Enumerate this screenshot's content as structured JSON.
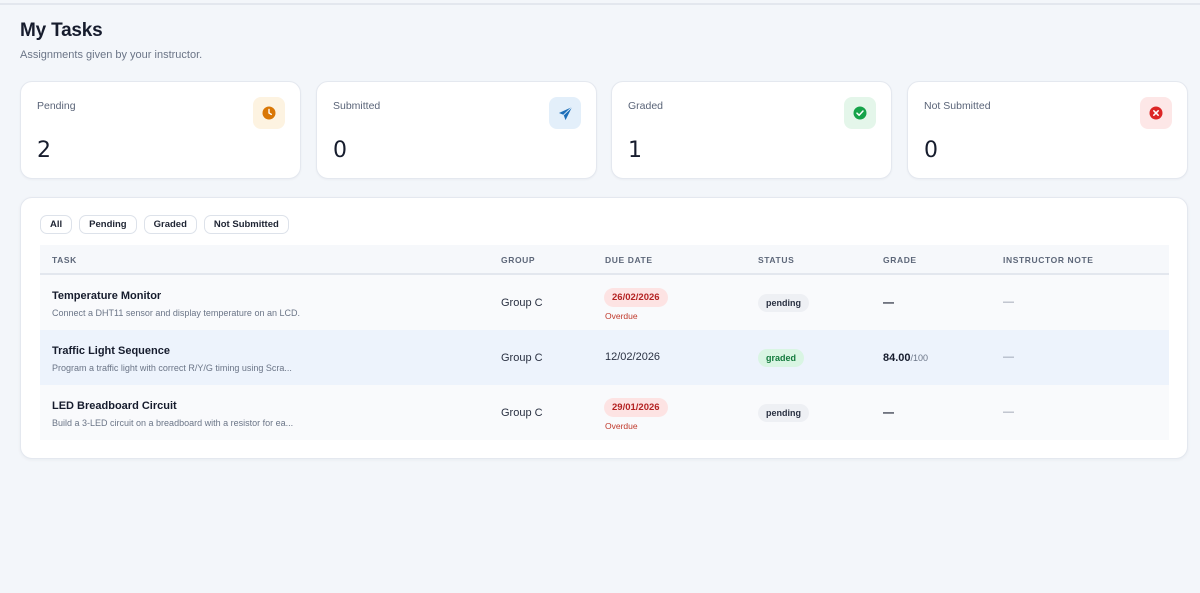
{
  "page": {
    "title": "My Tasks",
    "subtitle": "Assignments given by your instructor."
  },
  "stats": [
    {
      "label": "Pending",
      "value": "2",
      "icon": "clock-icon",
      "color": "#d97706",
      "bg": "#fdf3e1"
    },
    {
      "label": "Submitted",
      "value": "0",
      "icon": "paper-plane-icon",
      "color": "#1d6fb8",
      "bg": "#e3effa"
    },
    {
      "label": "Graded",
      "value": "1",
      "icon": "check-circle-icon",
      "color": "#16a34a",
      "bg": "#e4f6ea"
    },
    {
      "label": "Not Submitted",
      "value": "0",
      "icon": "x-circle-icon",
      "color": "#dc2626",
      "bg": "#fde7e7"
    }
  ],
  "filters": [
    "All",
    "Pending",
    "Graded",
    "Not Submitted"
  ],
  "table": {
    "columns": [
      "TASK",
      "GROUP",
      "DUE DATE",
      "STATUS",
      "GRADE",
      "INSTRUCTOR NOTE"
    ],
    "rows": [
      {
        "title": "Temperature Monitor",
        "description": "Connect a DHT11 sensor and display temperature on an LCD.",
        "group": "Group C",
        "due": "26/02/2026",
        "overdue": "Overdue",
        "status": "pending",
        "grade": "—",
        "grade_max": "",
        "note": "—"
      },
      {
        "title": "Traffic Light Sequence",
        "description": "Program a traffic light with correct R/Y/G timing using Scra...",
        "group": "Group C",
        "due": "12/02/2026",
        "overdue": "",
        "status": "graded",
        "grade": "84.00",
        "grade_max": "/100",
        "note": "—"
      },
      {
        "title": "LED Breadboard Circuit",
        "description": "Build a 3-LED circuit on a breadboard with a resistor for ea...",
        "group": "Group C",
        "due": "29/01/2026",
        "overdue": "Overdue",
        "status": "pending",
        "grade": "—",
        "grade_max": "",
        "note": "—"
      }
    ]
  }
}
